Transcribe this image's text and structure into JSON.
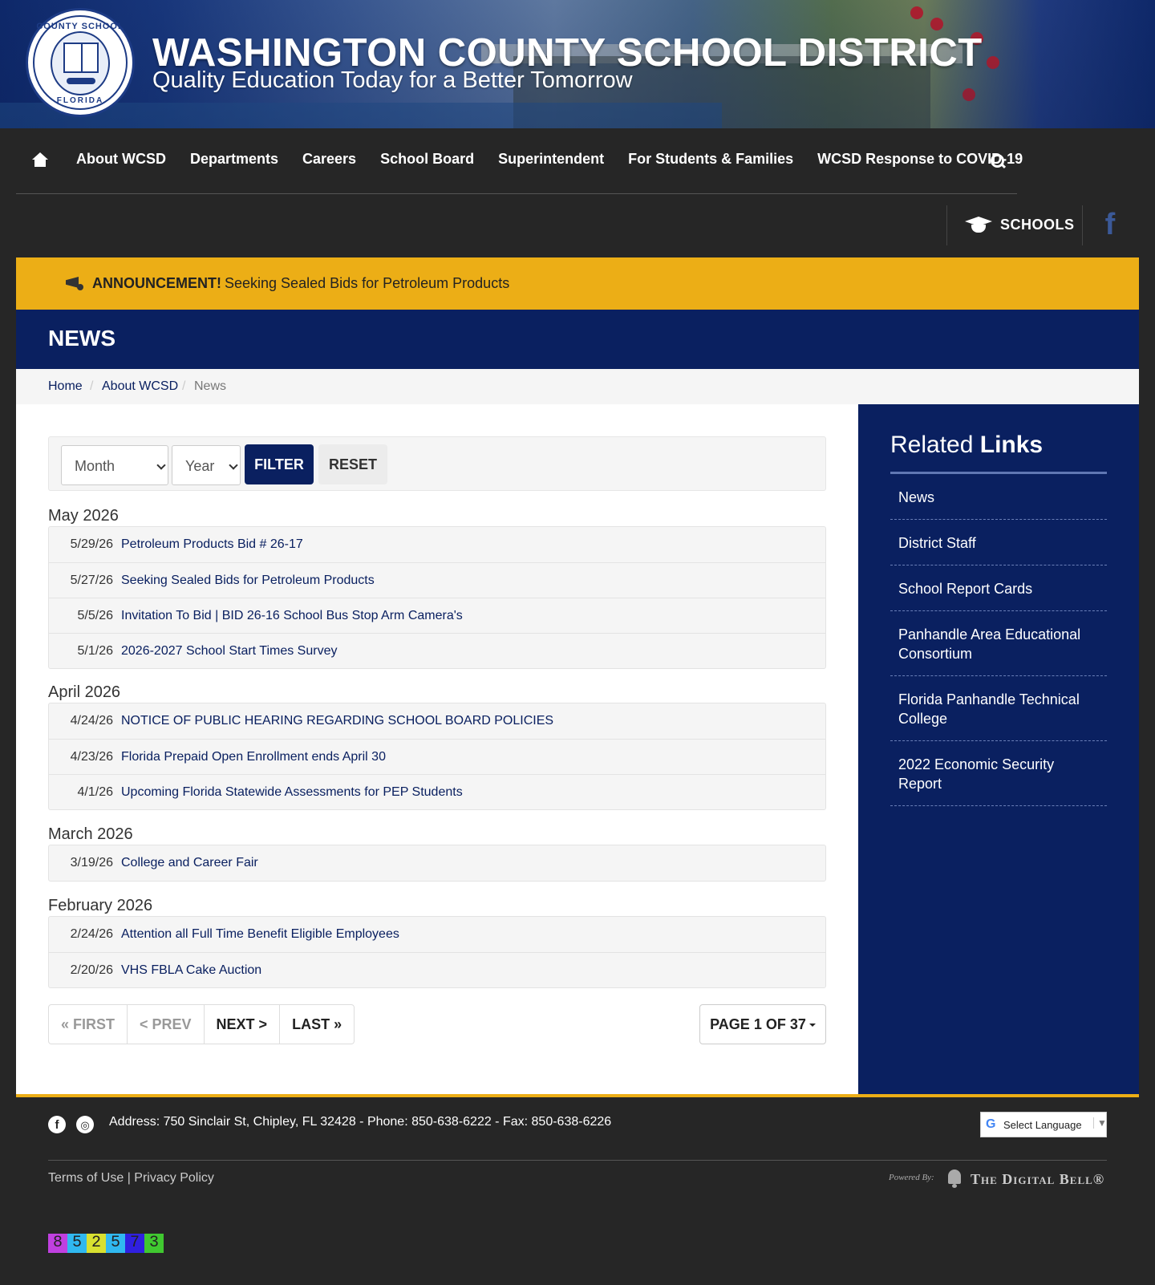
{
  "header": {
    "title": "WASHINGTON COUNTY SCHOOL DISTRICT",
    "tagline": "Quality Education Today for a Better Tomorrow",
    "seal_top": "COUNTY SCHOOL",
    "seal_bottom": "FLORIDA"
  },
  "nav": {
    "items": [
      {
        "label": "About WCSD"
      },
      {
        "label": "Departments"
      },
      {
        "label": "Careers"
      },
      {
        "label": "School Board"
      },
      {
        "label": "Superintendent"
      },
      {
        "label": "For Students & Families"
      },
      {
        "label": "WCSD Response to COVID-19"
      }
    ],
    "home_icon": "home-icon",
    "search_icon": "search-icon"
  },
  "utility": {
    "schools_label": "SCHOOLS",
    "facebook_glyph": "f"
  },
  "announcement": {
    "title": "ANNOUNCEMENT!",
    "text": "Seeking Sealed Bids for Petroleum Products"
  },
  "page": {
    "title": "NEWS"
  },
  "breadcrumb": {
    "home": "Home",
    "sep": "/",
    "about": "About WCSD",
    "current": "News"
  },
  "filter": {
    "month_value": "Month",
    "year_value": "Year",
    "filter_label": "FILTER",
    "reset_label": "RESET"
  },
  "news": {
    "groups": [
      {
        "month": "May 2026",
        "items": [
          {
            "date": "5/29/26",
            "title": "Petroleum Products Bid # 26-17"
          },
          {
            "date": "5/27/26",
            "title": "Seeking Sealed Bids for Petroleum Products"
          },
          {
            "date": "5/5/26",
            "title": "Invitation To Bid | BID 26-16 School Bus Stop Arm Camera's"
          },
          {
            "date": "5/1/26",
            "title": "2026-2027 School Start Times Survey"
          }
        ]
      },
      {
        "month": "April 2026",
        "items": [
          {
            "date": "4/24/26",
            "title": "NOTICE OF PUBLIC HEARING REGARDING SCHOOL BOARD POLICIES"
          },
          {
            "date": "4/23/26",
            "title": "Florida Prepaid Open Enrollment ends April 30"
          },
          {
            "date": "4/1/26",
            "title": "Upcoming Florida Statewide Assessments for PEP Students"
          }
        ]
      },
      {
        "month": "March 2026",
        "items": [
          {
            "date": "3/19/26",
            "title": "College and Career Fair"
          }
        ]
      },
      {
        "month": "February 2026",
        "items": [
          {
            "date": "2/24/26",
            "title": "Attention all Full Time Benefit Eligible Employees"
          },
          {
            "date": "2/20/26",
            "title": "VHS FBLA Cake Auction"
          }
        ]
      }
    ]
  },
  "pagination": {
    "first": "« FIRST",
    "prev": "< PREV",
    "next": "NEXT >",
    "last": "LAST »",
    "page_of": "PAGE 1 OF 37"
  },
  "sidebar": {
    "title_light": "Related",
    "title_bold": "Links",
    "links": [
      {
        "label": "News"
      },
      {
        "label": "District Staff"
      },
      {
        "label": "School Report Cards"
      },
      {
        "label": "Panhandle Area Educational Consortium"
      },
      {
        "label": "Florida Panhandle Technical College"
      },
      {
        "label": "2022 Economic Security Report"
      }
    ]
  },
  "footer": {
    "address": "Address: 750 Sinclair St, Chipley, FL 32428 - Phone: 850-638-6222 - Fax: 850-638-6226",
    "facebook_glyph": "f",
    "rss_glyph": "◎",
    "language_g": "G",
    "language_label": "Select Language",
    "language_arrow": "▼",
    "terms": "Terms of Use",
    "links_sep": " | ",
    "privacy": "Privacy Policy",
    "powered_by": "Powered By:",
    "brand": "The Digital Bell®",
    "counter": [
      {
        "digit": "8",
        "color": "#c040e0"
      },
      {
        "digit": "5",
        "color": "#30b8f0"
      },
      {
        "digit": "2",
        "color": "#d8e030"
      },
      {
        "digit": "5",
        "color": "#30b8f0"
      },
      {
        "digit": "7",
        "color": "#3020e0"
      },
      {
        "digit": "3",
        "color": "#40c830"
      }
    ]
  },
  "colors": {
    "navy": "#0a2060",
    "gold": "#ecae16",
    "dark": "#262626"
  }
}
